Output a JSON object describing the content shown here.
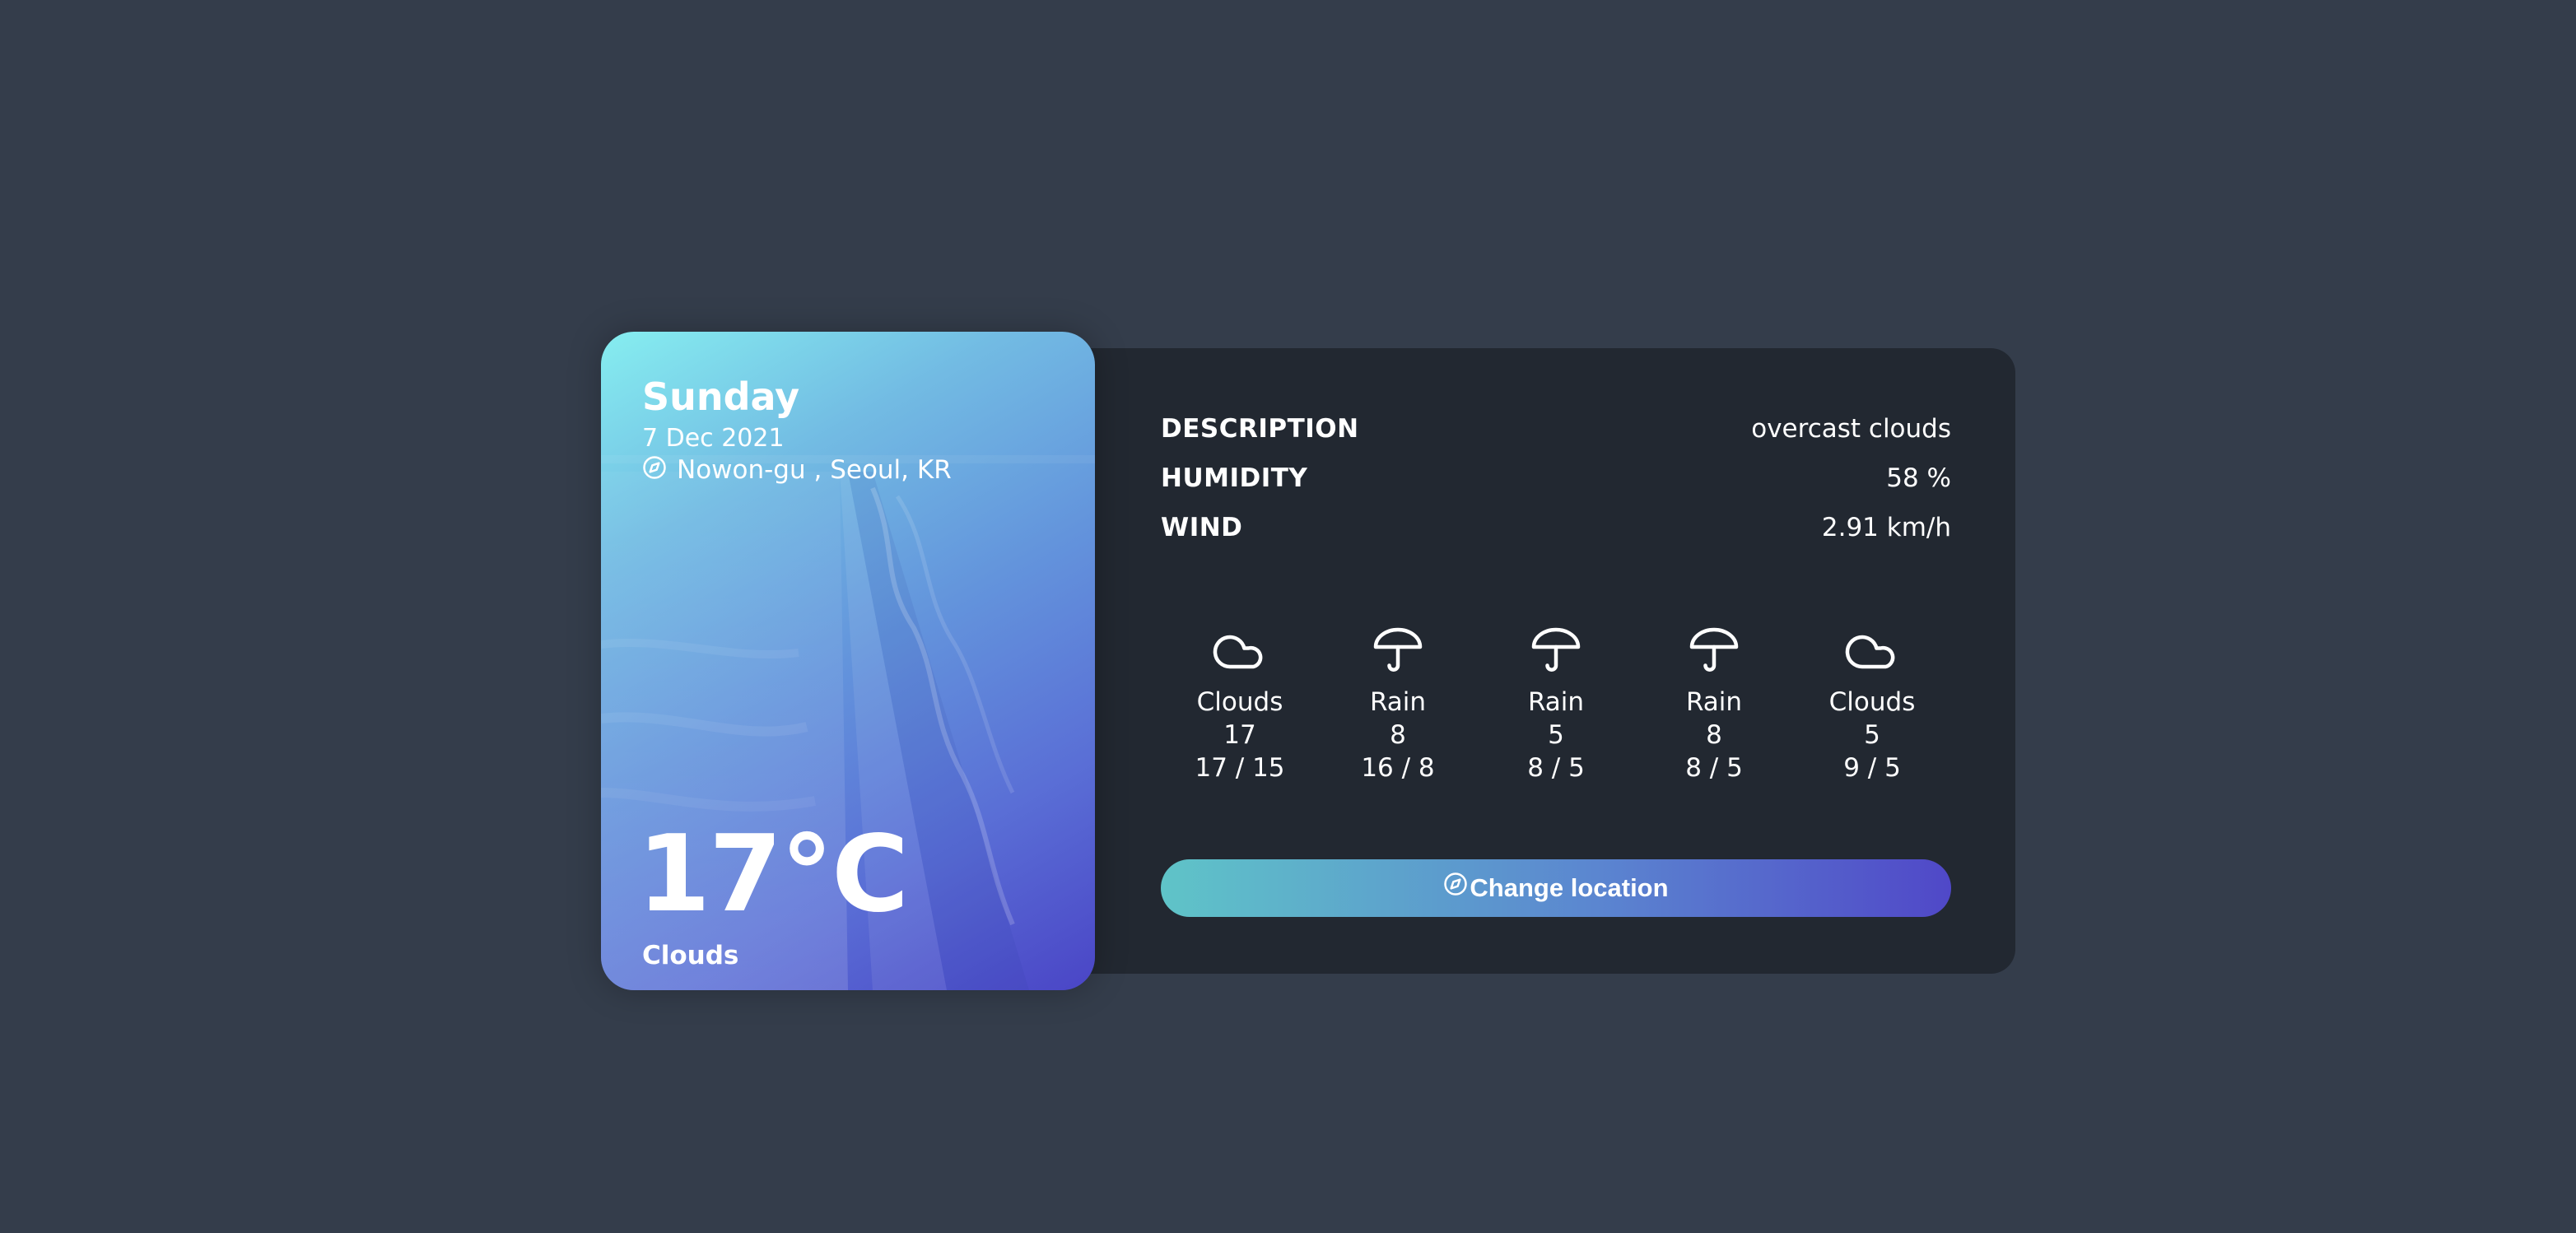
{
  "details": {
    "description": {
      "label": "DESCRIPTION",
      "value": "overcast clouds"
    },
    "humidity": {
      "label": "HUMIDITY",
      "value": "58 %"
    },
    "wind": {
      "label": "WIND",
      "value": "2.91 km/h"
    }
  },
  "forecast": [
    {
      "icon": "cloud-icon",
      "condition": "Clouds",
      "temp": "17",
      "range": "17 / 15"
    },
    {
      "icon": "umbrella-icon",
      "condition": "Rain",
      "temp": "8",
      "range": "16 / 8"
    },
    {
      "icon": "umbrella-icon",
      "condition": "Rain",
      "temp": "5",
      "range": "8 / 5"
    },
    {
      "icon": "umbrella-icon",
      "condition": "Rain",
      "temp": "8",
      "range": "8 / 5"
    },
    {
      "icon": "cloud-icon",
      "condition": "Clouds",
      "temp": "5",
      "range": "9 / 5"
    }
  ],
  "change_location_button": {
    "label": "Change location",
    "icon": "compass-icon"
  },
  "card": {
    "day": "Sunday",
    "date": "7 Dec 2021",
    "location": "Nowon-gu , Seoul, KR",
    "location_icon": "compass-icon",
    "temperature": "17°C",
    "condition": "Clouds"
  },
  "colors": {
    "page_background": "#343d4b",
    "panel_background": "#222831",
    "gradient_start": "#86eef0",
    "gradient_end": "#4a45c6",
    "button_gradient_start": "#5fc4c8",
    "button_gradient_end": "#5048c8"
  }
}
